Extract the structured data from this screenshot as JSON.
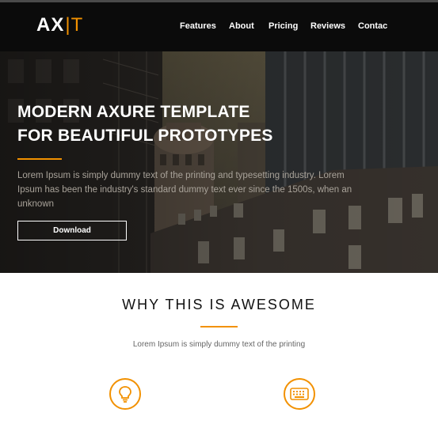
{
  "brand": {
    "logo_main": "AX",
    "logo_accent": "T",
    "accent_color": "#f29100"
  },
  "nav": {
    "items": [
      {
        "label": "Features"
      },
      {
        "label": "About"
      },
      {
        "label": "Pricing"
      },
      {
        "label": "Reviews"
      },
      {
        "label": "Contac"
      }
    ]
  },
  "hero": {
    "title_line1": "MODERN AXURE TEMPLATE",
    "title_line2": "FOR BEAUTIFUL PROTOTYPES",
    "description": "Lorem Ipsum is simply dummy text of the printing and typesetting industry. Lorem Ipsum has been the industry's standard dummy text ever since the 1500s, when an unknown",
    "button_label": "Download"
  },
  "section": {
    "title": "WHY THIS IS AWESOME",
    "subtitle": "Lorem Ipsum is simply dummy text of the printing"
  },
  "features": [
    {
      "icon": "lightbulb-icon"
    },
    {
      "icon": "keyboard-icon"
    }
  ]
}
